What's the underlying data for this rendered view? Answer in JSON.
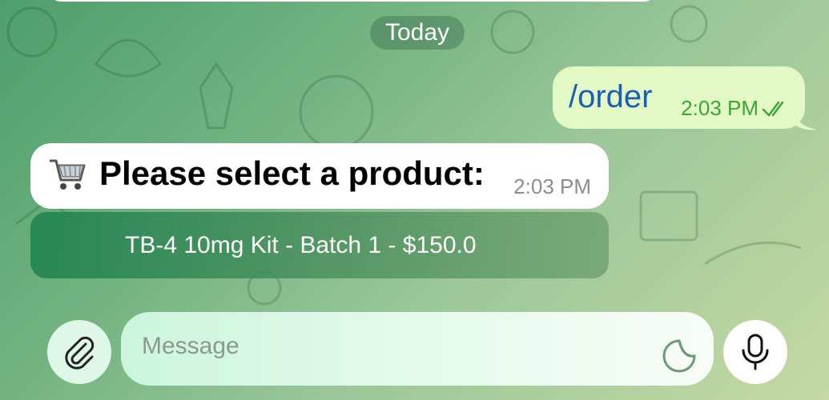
{
  "chat": {
    "date_separator": "Today",
    "outgoing": {
      "text": "/order",
      "time": "2:03 PM",
      "status_icon": "double-check-icon"
    },
    "incoming": {
      "emoji": "🛒",
      "text": "Please select a product:",
      "time": "2:03 PM"
    },
    "keyboard_button": {
      "label": "TB-4 10mg Kit - Batch 1 - $150.0"
    }
  },
  "composer": {
    "placeholder": "Message",
    "attach_icon": "paperclip-icon",
    "sticker_icon": "sticker-icon",
    "mic_icon": "microphone-icon"
  },
  "colors": {
    "outgoing_bubble": "#e2f8c5",
    "outgoing_text": "#1a5fb4",
    "outgoing_time": "#3ea536",
    "incoming_bubble": "#ffffff",
    "keyboard_button": "#2a8a58"
  }
}
